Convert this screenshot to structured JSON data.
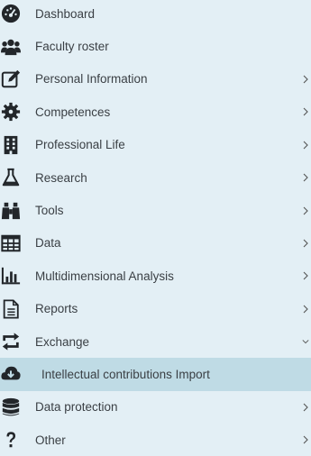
{
  "menu": {
    "items": [
      {
        "label": "Dashboard",
        "icon": "dashboard-icon",
        "chevron": ""
      },
      {
        "label": "Faculty roster",
        "icon": "users-icon",
        "chevron": ""
      },
      {
        "label": "Personal Information",
        "icon": "edit-icon",
        "chevron": "right"
      },
      {
        "label": "Competences",
        "icon": "gear-icon",
        "chevron": "right"
      },
      {
        "label": "Professional Life",
        "icon": "building-icon",
        "chevron": "right"
      },
      {
        "label": "Research",
        "icon": "flask-icon",
        "chevron": "right"
      },
      {
        "label": "Tools",
        "icon": "binoculars-icon",
        "chevron": "right"
      },
      {
        "label": "Data",
        "icon": "table-icon",
        "chevron": "right"
      },
      {
        "label": "Multidimensional Analysis",
        "icon": "bar-chart-icon",
        "chevron": "right"
      },
      {
        "label": "Reports",
        "icon": "document-icon",
        "chevron": "right"
      },
      {
        "label": "Exchange",
        "icon": "exchange-icon",
        "chevron": "down"
      },
      {
        "label": "Intellectual contributions Import",
        "icon": "cloud-download-icon",
        "chevron": "",
        "selected": true
      },
      {
        "label": "Data protection",
        "icon": "database-icon",
        "chevron": "right"
      },
      {
        "label": "Other",
        "icon": "question-icon",
        "chevron": "right"
      }
    ]
  },
  "colors": {
    "background": "#e3eff5",
    "selected_background": "#bfdbe5",
    "icon": "#22262a",
    "text": "#3a3f44"
  }
}
